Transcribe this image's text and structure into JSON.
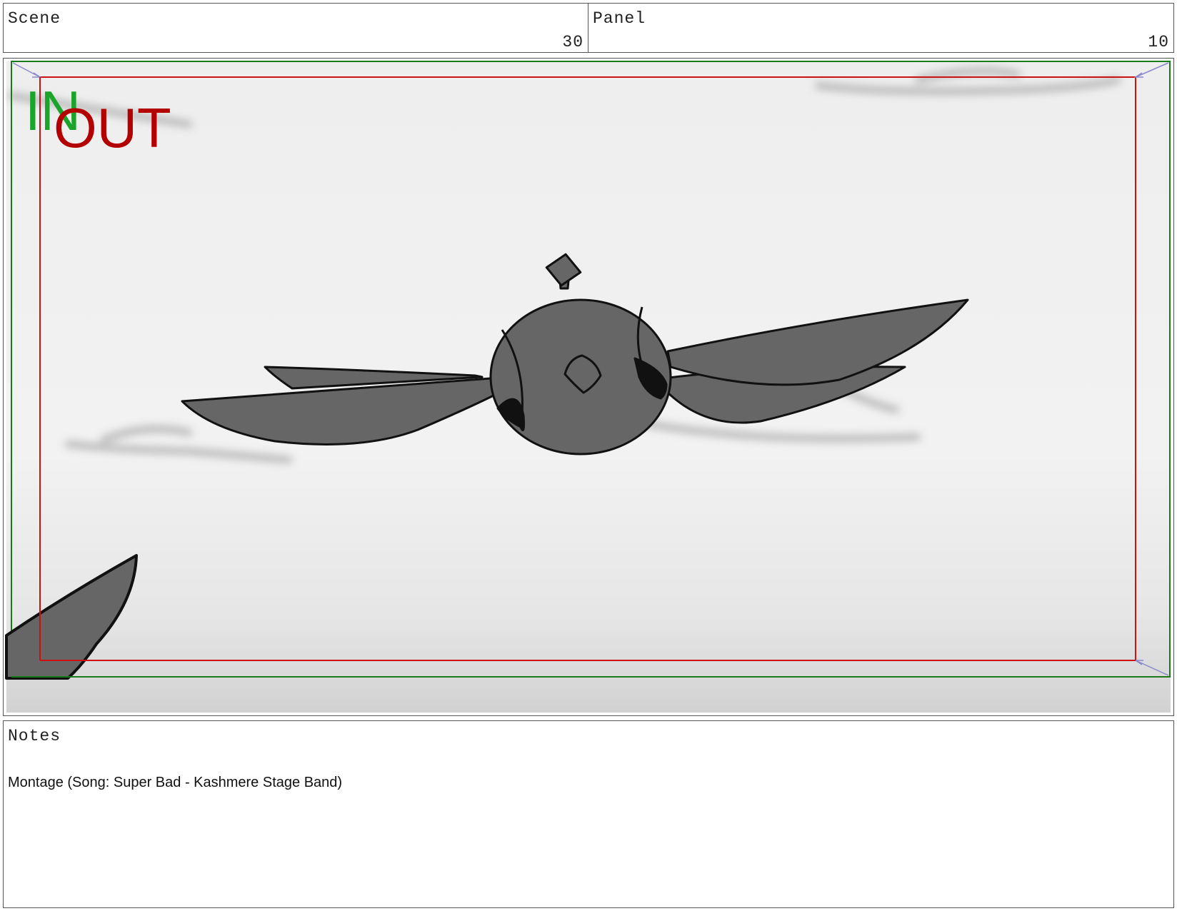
{
  "scene": {
    "label": "Scene",
    "value": "30"
  },
  "panel": {
    "label": "Panel",
    "value": "10"
  },
  "frame": {
    "in_label": "IN",
    "out_label": "OUT",
    "colors": {
      "in_frame": "#1a7a1a",
      "out_frame": "#cc1111",
      "in_text": "#1aa52a",
      "out_text": "#b30000",
      "guide_arrows": "#8888cc",
      "character_fill": "#666666"
    }
  },
  "notes": {
    "label": "Notes",
    "text": "Montage (Song: Super Bad - Kashmere Stage Band)"
  }
}
